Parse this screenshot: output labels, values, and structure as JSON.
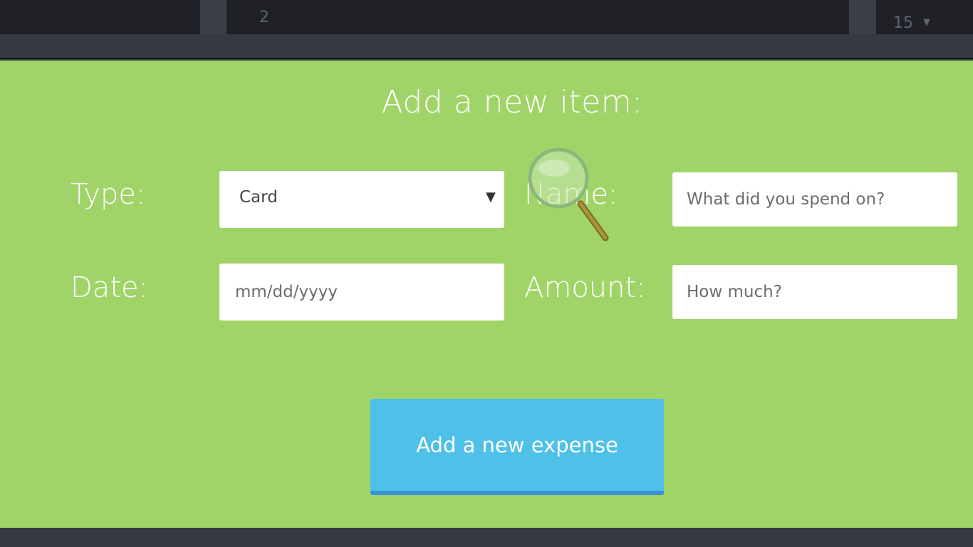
{
  "top": {
    "line_left": "2",
    "line_right": "15",
    "dropdown_icon": "caret-down-icon"
  },
  "form": {
    "title": "Add a new item:",
    "type_label": "Type:",
    "type_value": "Card",
    "name_label": "Name:",
    "name_placeholder": "What did you spend on?",
    "date_label": "Date:",
    "date_placeholder": "mm/dd/yyyy",
    "amount_label": "Amount:",
    "amount_placeholder": "How much?",
    "submit_label": "Add a new expense"
  },
  "colors": {
    "panel": "#a0d468",
    "button": "#4fc0e8",
    "button_border": "#3a8fd9",
    "dark_bar": "#1f2127"
  },
  "cursor_icon": "magnifier-icon"
}
